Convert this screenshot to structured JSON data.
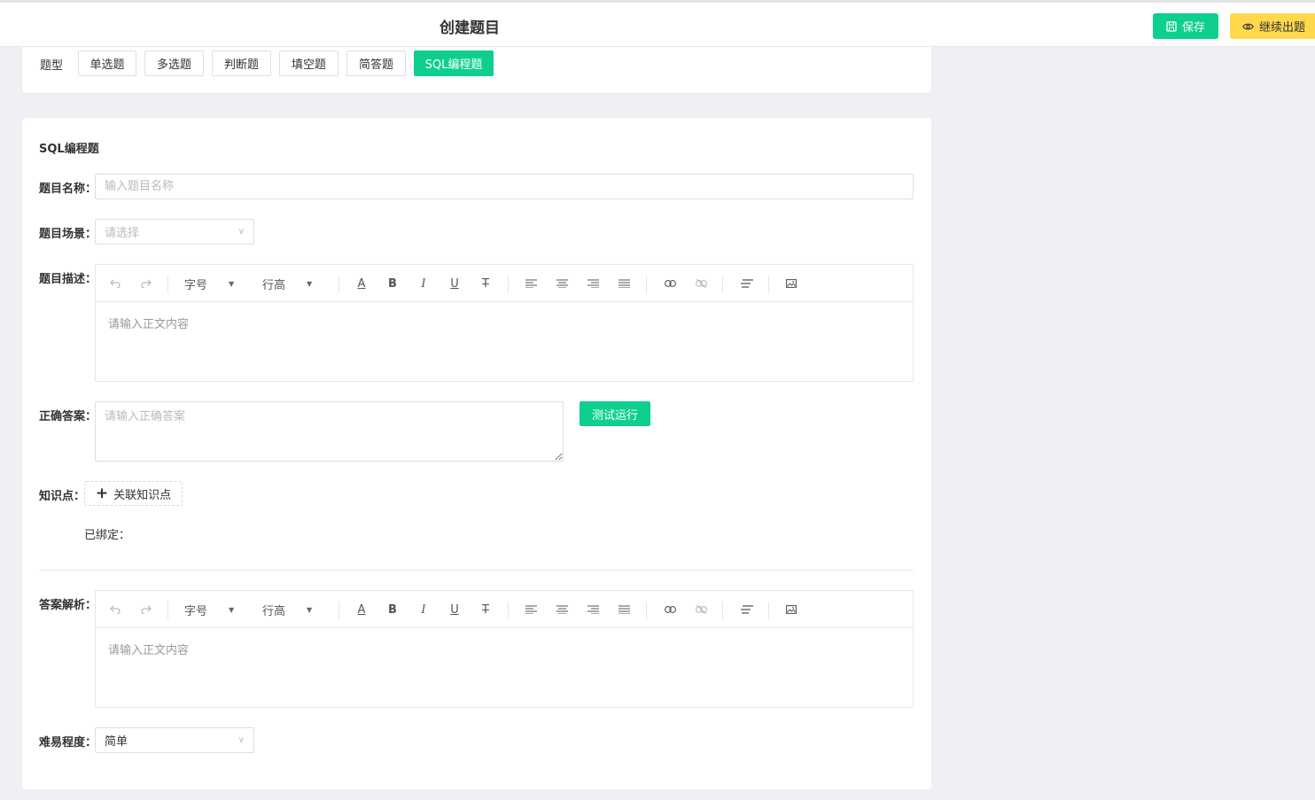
{
  "header": {
    "title": "创建题目",
    "save_label": "保存",
    "continue_label": "继续出题"
  },
  "question_type": {
    "label": "题型",
    "options": [
      "单选题",
      "多选题",
      "判断题",
      "填空题",
      "简答题",
      "SQL编程题"
    ],
    "selected": "SQL编程题"
  },
  "form": {
    "section_title": "SQL编程题",
    "name": {
      "label": "题目名称：",
      "placeholder": "输入题目名称"
    },
    "scene": {
      "label": "题目场景：",
      "placeholder": "请选择"
    },
    "description": {
      "label": "题目描述：",
      "placeholder": "请输入正文内容"
    },
    "answer": {
      "label": "正确答案：",
      "placeholder": "请输入正确答案",
      "test_button": "测试运行"
    },
    "knowledge": {
      "label": "知识点：",
      "link_button": "关联知识点",
      "bound_label": "已绑定："
    },
    "analysis": {
      "label": "答案解析：",
      "placeholder": "请输入正文内容"
    },
    "difficulty": {
      "label": "难易程度：",
      "value": "简单"
    }
  },
  "editor_toolbar": {
    "font_size": "字号",
    "line_height": "行高",
    "icons": [
      "undo-icon",
      "redo-icon",
      "font-color-icon",
      "bold-icon",
      "italic-icon",
      "underline-icon",
      "strikethrough-icon",
      "align-left-icon",
      "align-center-icon",
      "align-right-icon",
      "align-justify-icon",
      "link-icon",
      "unlink-icon",
      "clear-format-icon",
      "image-icon"
    ],
    "bold_glyph": "B",
    "italic_glyph": "I",
    "underline_glyph": "U",
    "strike_glyph": "T",
    "font_color_glyph": "A"
  },
  "colors": {
    "primary": "#0fcf8f",
    "warning": "#ffd84e"
  }
}
